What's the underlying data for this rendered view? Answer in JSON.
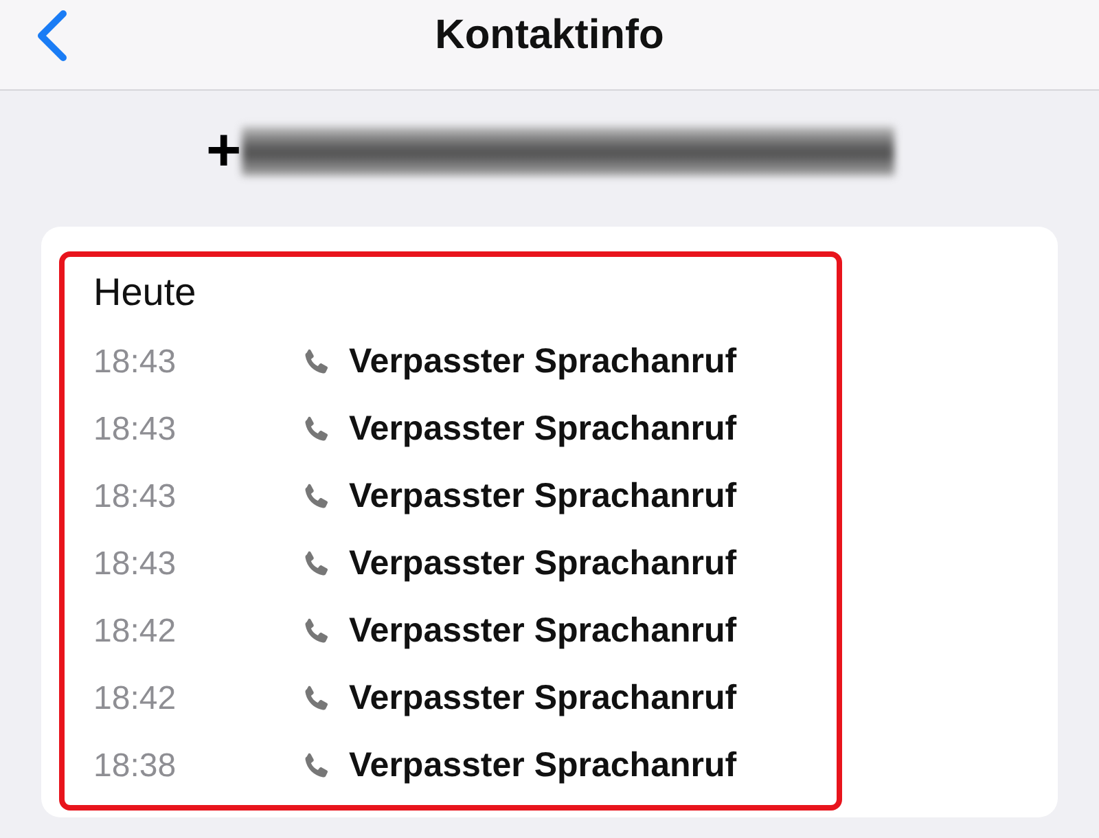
{
  "header": {
    "title": "Kontaktinfo"
  },
  "contact": {
    "phone_prefix": "+"
  },
  "call_log": {
    "section": "Heute",
    "calls": [
      {
        "time": "18:43",
        "label": "Verpasster Sprachanruf"
      },
      {
        "time": "18:43",
        "label": "Verpasster Sprachanruf"
      },
      {
        "time": "18:43",
        "label": "Verpasster Sprachanruf"
      },
      {
        "time": "18:43",
        "label": "Verpasster Sprachanruf"
      },
      {
        "time": "18:42",
        "label": "Verpasster Sprachanruf"
      },
      {
        "time": "18:42",
        "label": "Verpasster Sprachanruf"
      },
      {
        "time": "18:38",
        "label": "Verpasster Sprachanruf"
      }
    ]
  }
}
